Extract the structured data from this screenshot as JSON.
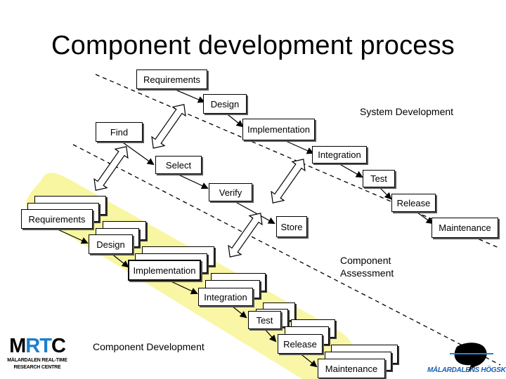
{
  "title": "Component development process",
  "system_development": {
    "label": "System Development",
    "steps": [
      "Requirements",
      "Design",
      "Implementation",
      "Integration",
      "Test",
      "Release",
      "Maintenance"
    ]
  },
  "component_assessment": {
    "label_line1": "Component",
    "label_line2": "Assessment",
    "steps": [
      "Find",
      "Select",
      "Verify",
      "Store"
    ]
  },
  "component_development": {
    "label": "Component Development",
    "steps": [
      "Requirements",
      "Design",
      "Implementation",
      "Integration",
      "Test",
      "Release",
      "Maintenance"
    ]
  },
  "logos": {
    "mrtc_m": "M",
    "mrtc_rt": "RT",
    "mrtc_c": "C",
    "mrtc_line1": "MÄLARDALEN REAL-TIME",
    "mrtc_line2": "RESEARCH CENTRE",
    "mdh": "MÄLARDALENS HÖGSKOLA"
  },
  "colors": {
    "band": "#f8f59a",
    "accent_blue": "#1a86e0",
    "mdh_blue": "#1a5fb4"
  }
}
